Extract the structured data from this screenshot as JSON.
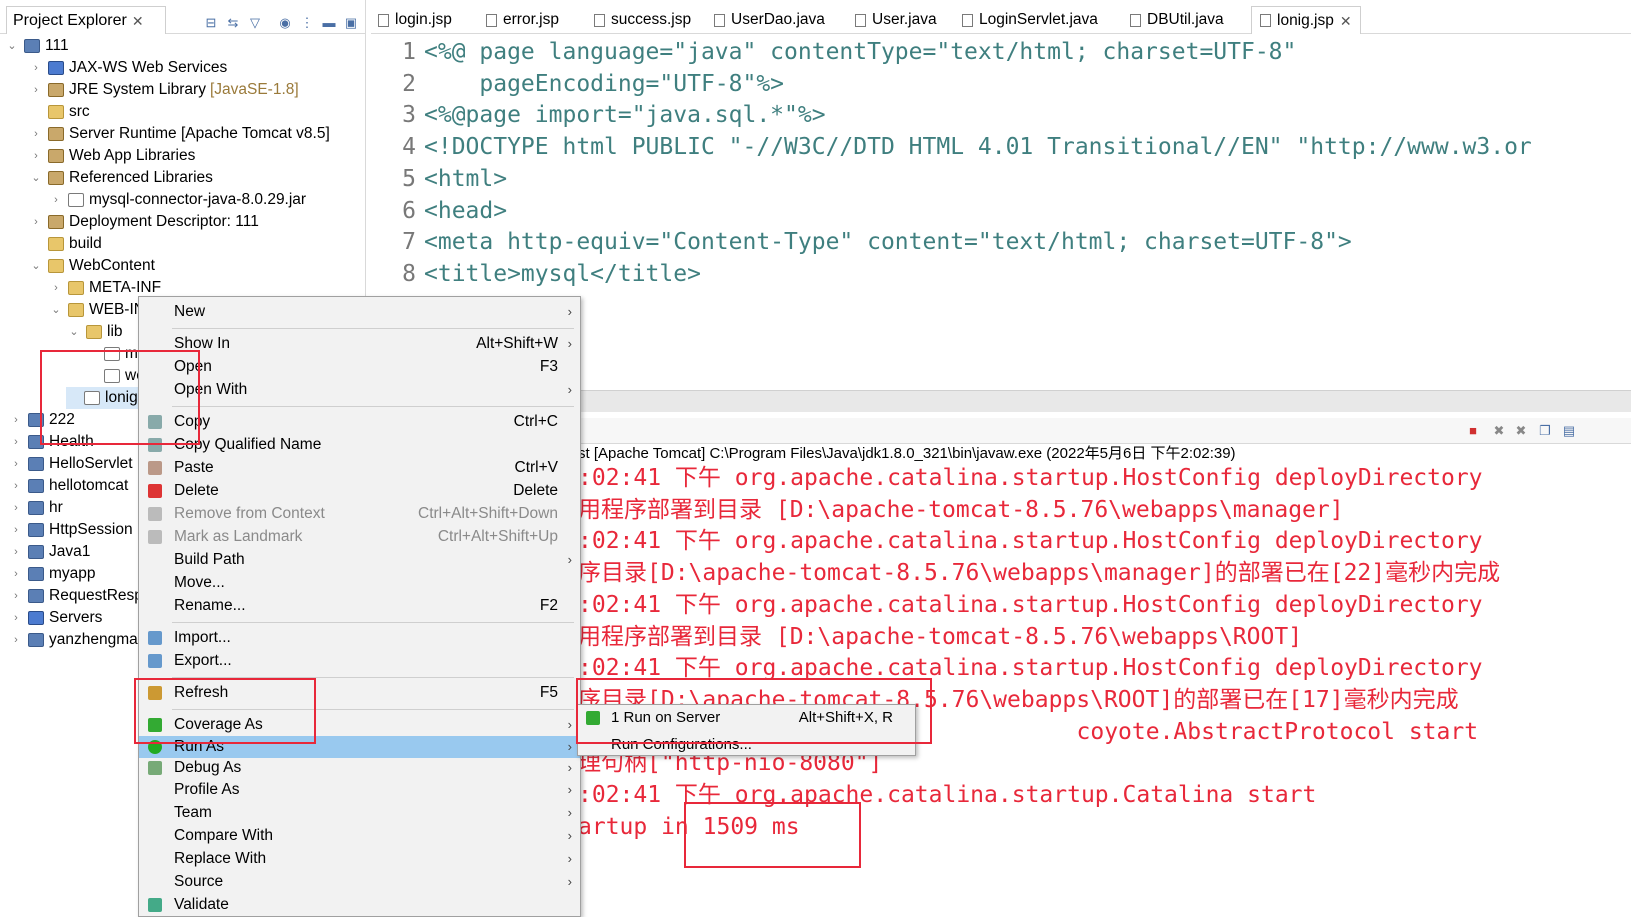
{
  "project_explorer": {
    "title": "Project Explorer",
    "tree": [
      {
        "label": "111",
        "extra": "",
        "icon": "project-icon",
        "expanded": true
      },
      {
        "label": "JAX-WS Web Services",
        "extra": "",
        "icon": "webservice-icon"
      },
      {
        "label": "JRE System Library",
        "extra": "[JavaSE-1.8]",
        "icon": "library-icon"
      },
      {
        "label": "src",
        "extra": "",
        "icon": "source-folder-icon"
      },
      {
        "label": "Server Runtime [Apache Tomcat v8.5]",
        "extra": "",
        "icon": "library-icon"
      },
      {
        "label": "Web App Libraries",
        "extra": "",
        "icon": "library-icon"
      },
      {
        "label": "Referenced Libraries",
        "extra": "",
        "icon": "library-icon"
      },
      {
        "label": "mysql-connector-java-8.0.29.jar",
        "extra": "",
        "icon": "jar-icon"
      },
      {
        "label": "Deployment Descriptor: 111",
        "extra": "",
        "icon": "descriptor-icon"
      },
      {
        "label": "build",
        "extra": "",
        "icon": "folder-icon"
      },
      {
        "label": "WebContent",
        "extra": "",
        "icon": "folder-icon"
      },
      {
        "label": "META-INF",
        "extra": "",
        "icon": "folder-icon"
      },
      {
        "label": "WEB-IN",
        "extra": "",
        "icon": "folder-icon"
      },
      {
        "label": "lib",
        "extra": "",
        "icon": "folder-icon"
      },
      {
        "label": "m",
        "extra": "",
        "icon": "jar-icon"
      },
      {
        "label": "web.",
        "extra": "",
        "icon": "xml-file-icon"
      },
      {
        "label": "lonig.js",
        "extra": "",
        "icon": "jsp-file-icon"
      },
      {
        "label": "222",
        "extra": "",
        "icon": "project-icon"
      },
      {
        "label": "Health",
        "extra": "",
        "icon": "project-icon"
      },
      {
        "label": "HelloServlet",
        "extra": "",
        "icon": "project-icon"
      },
      {
        "label": "hellotomcat",
        "extra": "",
        "icon": "project-icon"
      },
      {
        "label": "hr",
        "extra": "",
        "icon": "project-icon"
      },
      {
        "label": "HttpSession",
        "extra": "",
        "icon": "project-icon"
      },
      {
        "label": "Java1",
        "extra": "",
        "icon": "project-icon"
      },
      {
        "label": "myapp",
        "extra": "",
        "icon": "project-icon"
      },
      {
        "label": "RequestResp",
        "extra": "",
        "icon": "project-icon"
      },
      {
        "label": "Servers",
        "extra": "",
        "icon": "servers-icon"
      },
      {
        "label": "yanzhengma",
        "extra": "",
        "icon": "project-icon"
      }
    ]
  },
  "editor": {
    "tabs": [
      {
        "label": "login.jsp"
      },
      {
        "label": "error.jsp"
      },
      {
        "label": "success.jsp"
      },
      {
        "label": "UserDao.java"
      },
      {
        "label": "User.java"
      },
      {
        "label": "LoginServlet.java"
      },
      {
        "label": "DBUtil.java"
      },
      {
        "label": "lonig.jsp"
      }
    ],
    "code_lines": [
      {
        "num": "1",
        "text": "<%@ page language=\"java\" contentType=\"text/html; charset=UTF-8\""
      },
      {
        "num": "2",
        "text": "    pageEncoding=\"UTF-8\"%>"
      },
      {
        "num": "3",
        "text": "<%@page import=\"java.sql.*\"%>"
      },
      {
        "num": "4",
        "text": "<!DOCTYPE html PUBLIC \"-//W3C//DTD HTML 4.01 Transitional//EN\" \"http://www.w3.or"
      },
      {
        "num": "5",
        "text": "<html>"
      },
      {
        "num": "6",
        "text": "<head>"
      },
      {
        "num": "7",
        "text": "<meta http-equiv=\"Content-Type\" content=\"text/html; charset=UTF-8\">"
      },
      {
        "num": "8",
        "text": "<title>mysql</title>"
      }
    ]
  },
  "console": {
    "title": "st [Apache Tomcat] C:\\Program Files\\Java\\jdk1.8.0_321\\bin\\javaw.exe  (2022年5月6日 下午2:02:39)",
    "lines": [
      ":02:41 下午 org.apache.catalina.startup.HostConfig deployDirectory",
      "用程序部署到目录 [D:\\apache-tomcat-8.5.76\\webapps\\manager]",
      ":02:41 下午 org.apache.catalina.startup.HostConfig deployDirectory",
      "序目录[D:\\apache-tomcat-8.5.76\\webapps\\manager]的部署已在[22]毫秒内完成",
      ":02:41 下午 org.apache.catalina.startup.HostConfig deployDirectory",
      "用程序部署到目录 [D:\\apache-tomcat-8.5.76\\webapps\\ROOT]",
      ":02:41 下午 org.apache.catalina.startup.HostConfig deployDirectory",
      "序目录[D:\\apache-tomcat-8.5.76\\webapps\\ROOT]的部署已在[17]毫秒内完成",
      "                                    coyote.AbstractProtocol start",
      "理句柄[\"http-nio-8080\"]",
      ":02:41 下午 org.apache.catalina.startup.Catalina start",
      "artup in 1509 ms"
    ]
  },
  "context_menu": {
    "items": [
      {
        "label": "New",
        "accel": "",
        "submenu": true,
        "icon": "",
        "disabled": false
      },
      {
        "sep": true
      },
      {
        "label": "Show In",
        "accel": "Alt+Shift+W",
        "submenu": true,
        "icon": "",
        "disabled": false
      },
      {
        "label": "Open",
        "accel": "F3",
        "submenu": false,
        "icon": "",
        "disabled": false
      },
      {
        "label": "Open With",
        "accel": "",
        "submenu": true,
        "icon": "",
        "disabled": false
      },
      {
        "sep": true
      },
      {
        "label": "Copy",
        "accel": "Ctrl+C",
        "submenu": false,
        "icon": "copy-icon",
        "disabled": false
      },
      {
        "label": "Copy Qualified Name",
        "accel": "",
        "submenu": false,
        "icon": "copy-qualified-icon",
        "disabled": false
      },
      {
        "label": "Paste",
        "accel": "Ctrl+V",
        "submenu": false,
        "icon": "paste-icon",
        "disabled": false
      },
      {
        "label": "Delete",
        "accel": "Delete",
        "submenu": false,
        "icon": "delete-icon",
        "disabled": false
      },
      {
        "label": "Remove from Context",
        "accel": "Ctrl+Alt+Shift+Down",
        "submenu": false,
        "icon": "remove-context-icon",
        "disabled": true
      },
      {
        "label": "Mark as Landmark",
        "accel": "Ctrl+Alt+Shift+Up",
        "submenu": false,
        "icon": "landmark-icon",
        "disabled": true
      },
      {
        "label": "Build Path",
        "accel": "",
        "submenu": true,
        "icon": "",
        "disabled": false
      },
      {
        "label": "Move...",
        "accel": "",
        "submenu": false,
        "icon": "",
        "disabled": false
      },
      {
        "label": "Rename...",
        "accel": "F2",
        "submenu": false,
        "icon": "",
        "disabled": false
      },
      {
        "sep": true
      },
      {
        "label": "Import...",
        "accel": "",
        "submenu": false,
        "icon": "import-icon",
        "disabled": false
      },
      {
        "label": "Export...",
        "accel": "",
        "submenu": false,
        "icon": "export-icon",
        "disabled": false
      },
      {
        "sep": true
      },
      {
        "label": "Refresh",
        "accel": "F5",
        "submenu": false,
        "icon": "refresh-icon",
        "disabled": false
      },
      {
        "sep": true
      },
      {
        "label": "Coverage As",
        "accel": "",
        "submenu": true,
        "icon": "coverage-icon",
        "disabled": false
      },
      {
        "label": "Run As",
        "accel": "",
        "submenu": true,
        "icon": "run-icon",
        "disabled": false,
        "highlighted": true
      },
      {
        "label": "Debug As",
        "accel": "",
        "submenu": true,
        "icon": "debug-icon",
        "disabled": false
      },
      {
        "label": "Profile As",
        "accel": "",
        "submenu": true,
        "icon": "",
        "disabled": false
      },
      {
        "label": "Team",
        "accel": "",
        "submenu": true,
        "icon": "",
        "disabled": false
      },
      {
        "label": "Compare With",
        "accel": "",
        "submenu": true,
        "icon": "",
        "disabled": false
      },
      {
        "label": "Replace With",
        "accel": "",
        "submenu": true,
        "icon": "",
        "disabled": false
      },
      {
        "label": "Source",
        "accel": "",
        "submenu": true,
        "icon": "",
        "disabled": false
      },
      {
        "label": "Validate",
        "accel": "",
        "submenu": false,
        "icon": "validate-icon",
        "disabled": false
      }
    ]
  },
  "run_as_submenu": {
    "items": [
      {
        "label": "1 Run on Server",
        "accel": "Alt+Shift+X, R",
        "icon": "server-run-icon"
      },
      {
        "label": "Run Configurations...",
        "accel": "",
        "icon": ""
      }
    ]
  },
  "colors": {
    "highlight_box": "#e8283a",
    "menu_highlight": "#99c9ef",
    "console_text": "#e8283a"
  }
}
